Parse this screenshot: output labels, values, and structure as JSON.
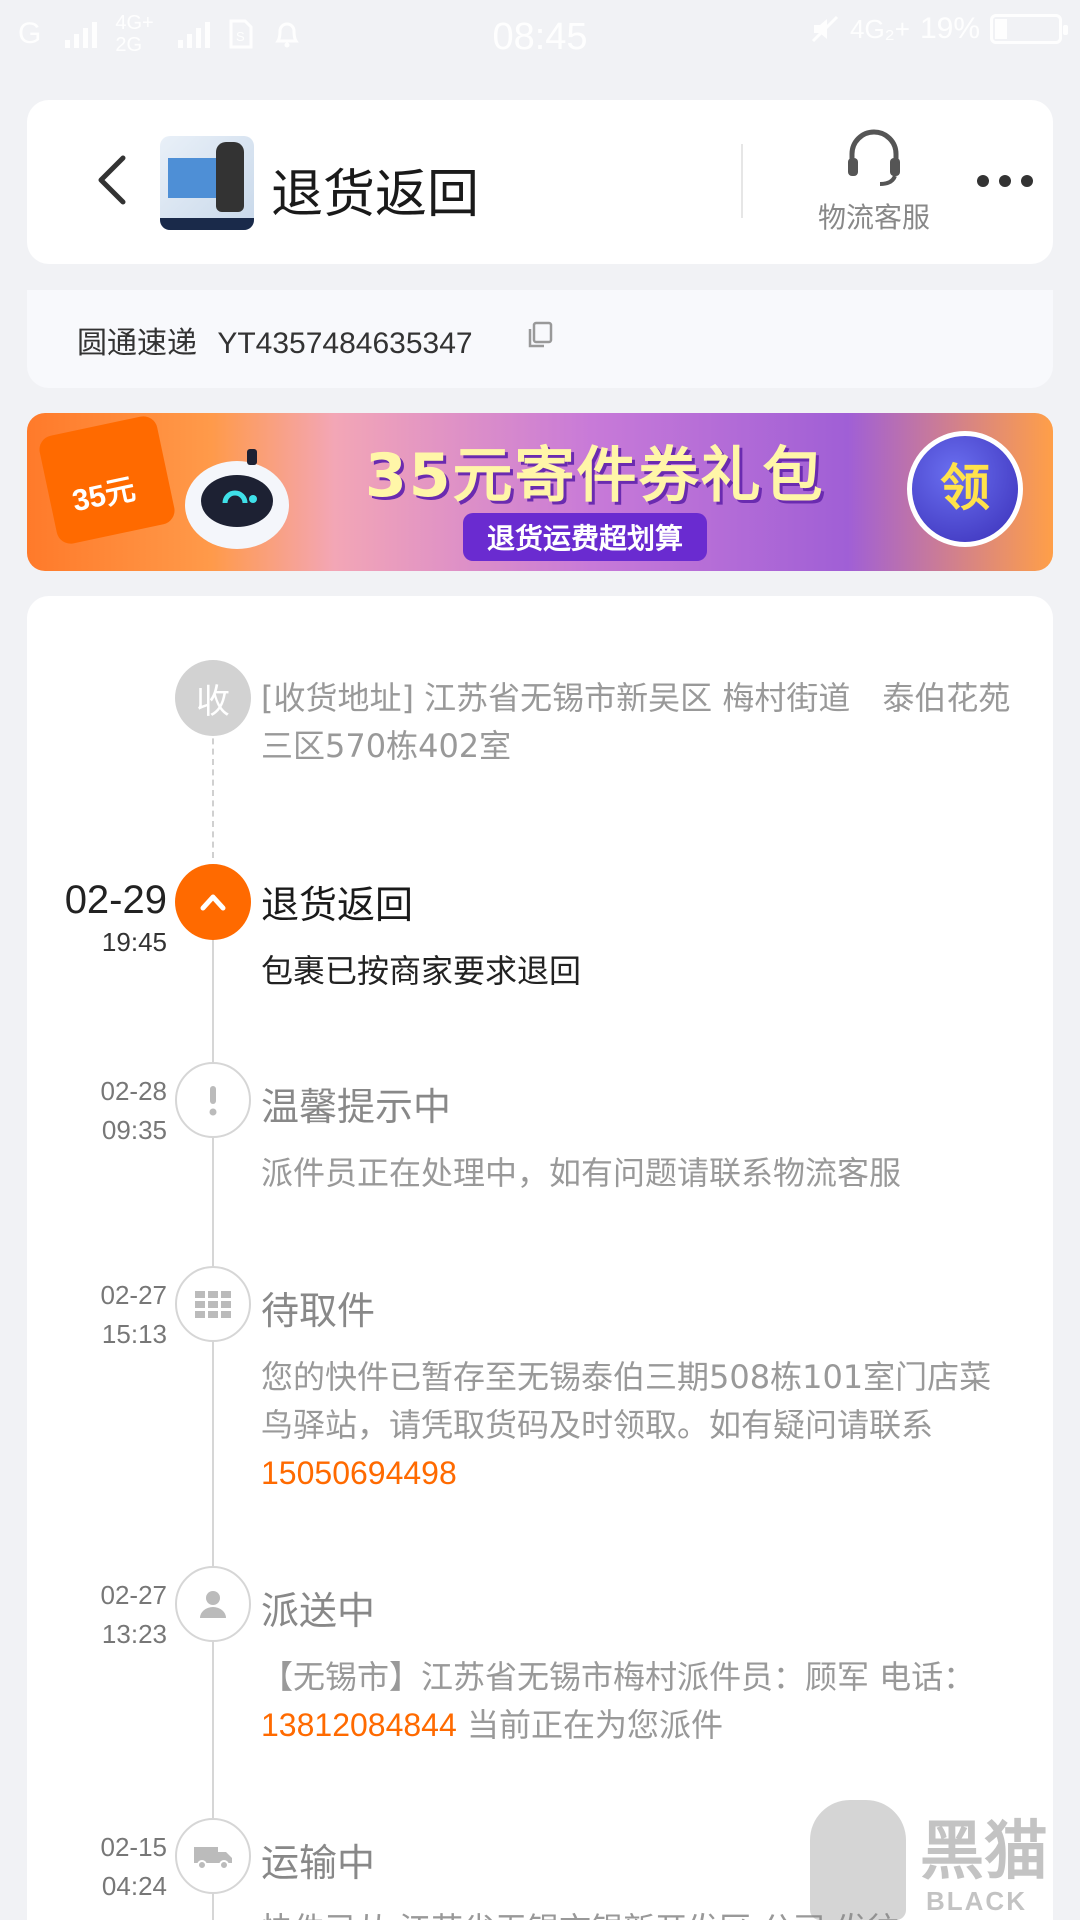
{
  "status_bar": {
    "carrier1": "G",
    "net1": "4G+",
    "net2": "2G",
    "time": "08:45",
    "net_right": "4G₂+",
    "battery": "19%"
  },
  "header": {
    "title": "退货返回",
    "cs_label": "物流客服"
  },
  "tracking": {
    "carrier": "圆通速递",
    "number": "YT4357484635347"
  },
  "banner": {
    "badge": "35元",
    "title": "35元寄件券礼包",
    "subtitle": "退货运费超划算",
    "button": "领"
  },
  "address": {
    "icon_text": "收",
    "text": "[收货地址] 江苏省无锡市新吴区 梅村街道　泰伯花苑三区570栋402室"
  },
  "events": [
    {
      "date": "02-29",
      "time": "19:45",
      "title": "退货返回",
      "desc": "包裹已按商家要求退回"
    },
    {
      "date": "02-28",
      "time": "09:35",
      "title": "温馨提示中",
      "desc": "派件员正在处理中，如有问题请联系物流客服"
    },
    {
      "date": "02-27",
      "time": "15:13",
      "title": "待取件",
      "desc": "您的快件已暂存至无锡泰伯三期508栋101室门店菜鸟驿站，请凭取货码及时领取。如有疑问请联系",
      "phone": "15050694498"
    },
    {
      "date": "02-27",
      "time": "13:23",
      "title": "派送中",
      "desc": "【无锡市】江苏省无锡市梅村派件员：顾军 电话：",
      "phone": "13812084844",
      "desc_after": " 当前正在为您派件"
    },
    {
      "date": "02-15",
      "time": "04:24",
      "title": "运输中",
      "desc": "快件已从 江苏省无锡市锡新开发区 公司 发往"
    }
  ],
  "watermark": {
    "zh": "黑猫",
    "en": "BLACK CAT"
  }
}
